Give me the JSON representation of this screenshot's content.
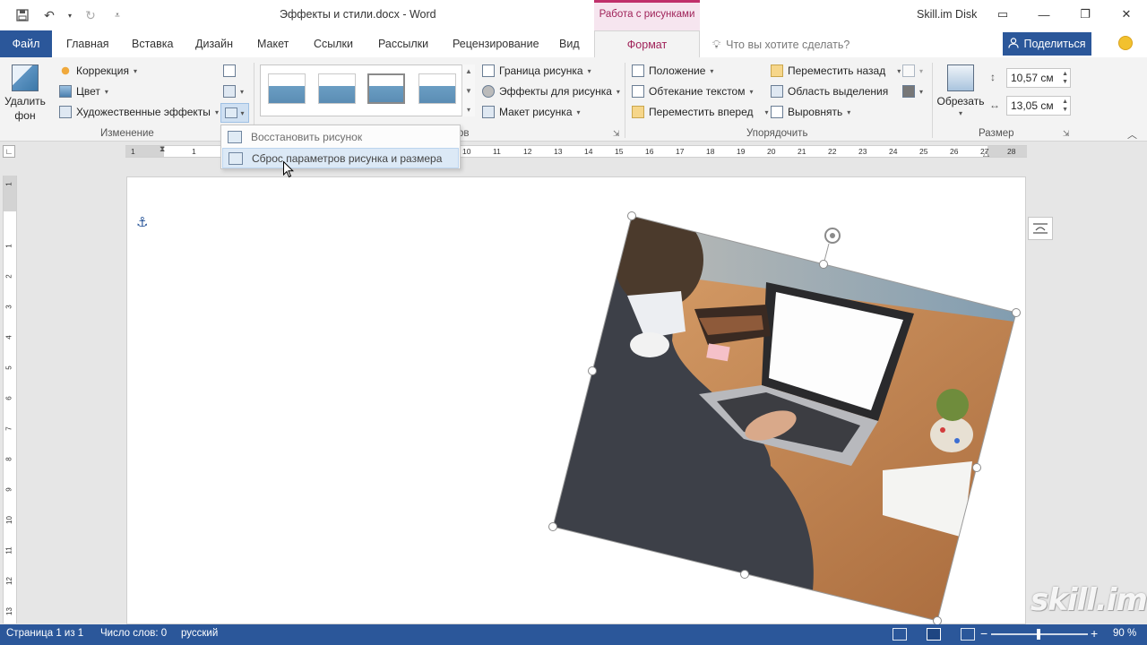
{
  "titlebar": {
    "doc_title": "Эффекты и стили.docx - Word",
    "context_group": "Работа с рисунками",
    "account": "Skill.im Disk"
  },
  "tabs": {
    "file": "Файл",
    "items": [
      "Главная",
      "Вставка",
      "Дизайн",
      "Макет",
      "Ссылки",
      "Рассылки",
      "Рецензирование",
      "Вид"
    ],
    "active": "Формат",
    "tell_me_placeholder": "Что вы хотите сделать?",
    "share": "Поделиться"
  },
  "ribbon": {
    "remove_bg": "Удалить фон",
    "correction": "Коррекция",
    "color": "Цвет",
    "artistic": "Художественные эффекты",
    "group_change": "Изменение",
    "group_styles_suffix": "ов",
    "picture_border": "Граница рисунка",
    "picture_effects": "Эффекты для рисунка",
    "picture_layout": "Макет рисунка",
    "position": "Положение",
    "wrap_text": "Обтекание текстом",
    "bring_forward": "Переместить вперед",
    "send_backward": "Переместить назад",
    "selection_pane": "Область выделения",
    "align": "Выровнять",
    "group_arrange": "Упорядочить",
    "crop": "Обрезать",
    "height": "10,57 см",
    "width": "13,05 см",
    "group_size": "Размер"
  },
  "menu": {
    "items": [
      "Восстановить рисунок",
      "Сброс параметров рисунка и размера"
    ],
    "highlighted_index": 1
  },
  "ruler": {
    "top": [
      "1",
      "1",
      "10",
      "11",
      "12",
      "13",
      "14",
      "15",
      "16",
      "17",
      "18",
      "19",
      "20",
      "21",
      "22",
      "23",
      "24",
      "25",
      "26",
      "27",
      "28"
    ],
    "left": [
      "1",
      "1",
      "2",
      "3",
      "4",
      "5",
      "6",
      "7",
      "8",
      "9",
      "10",
      "11",
      "12",
      "13"
    ]
  },
  "statusbar": {
    "page": "Страница 1 из 1",
    "words": "Число слов: 0",
    "language": "русский",
    "zoom": "90 %"
  },
  "watermark": "skill.im"
}
